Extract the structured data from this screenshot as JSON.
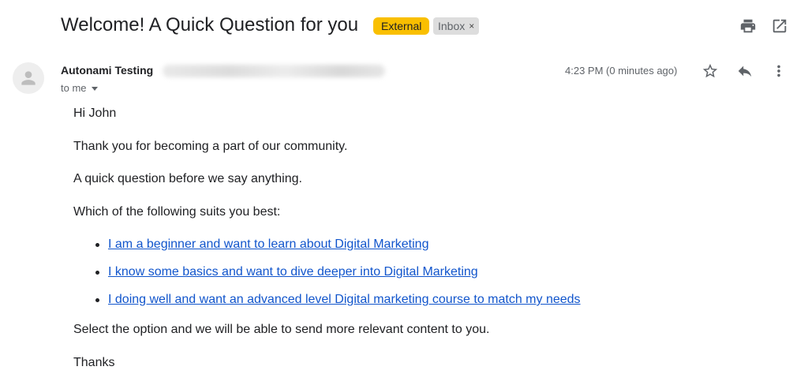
{
  "email": {
    "subject": "Welcome! A Quick Question for you",
    "labels": {
      "external": "External",
      "inbox": "Inbox",
      "inbox_remove": "×"
    },
    "sender": {
      "name": "Autonami Testing"
    },
    "recipient": {
      "to": "to me"
    },
    "timestamp": "4:23 PM (0 minutes ago)",
    "body": {
      "greeting": "Hi John",
      "line1": "Thank you for becoming a part of our community.",
      "line2": "A quick question before we say anything.",
      "line3": "Which of the following suits you best:",
      "options": [
        "I am a beginner and want to learn about Digital Marketing",
        "I know some basics and want to dive deeper into Digital Marketing",
        "I doing well and want an advanced level Digital marketing course to match my needs"
      ],
      "line4": "Select the option and we will be able to send more relevant content to you.",
      "signoff": "Thanks"
    }
  },
  "icons": {
    "print": "print-icon",
    "open_new_window": "open-in-new-window-icon",
    "star": "star-icon",
    "reply": "reply-icon",
    "more": "more-vert-icon",
    "avatar": "person-icon"
  },
  "colors": {
    "external_badge": "#f9bf00",
    "inbox_badge": "#dddddd",
    "link": "#1155cc"
  }
}
